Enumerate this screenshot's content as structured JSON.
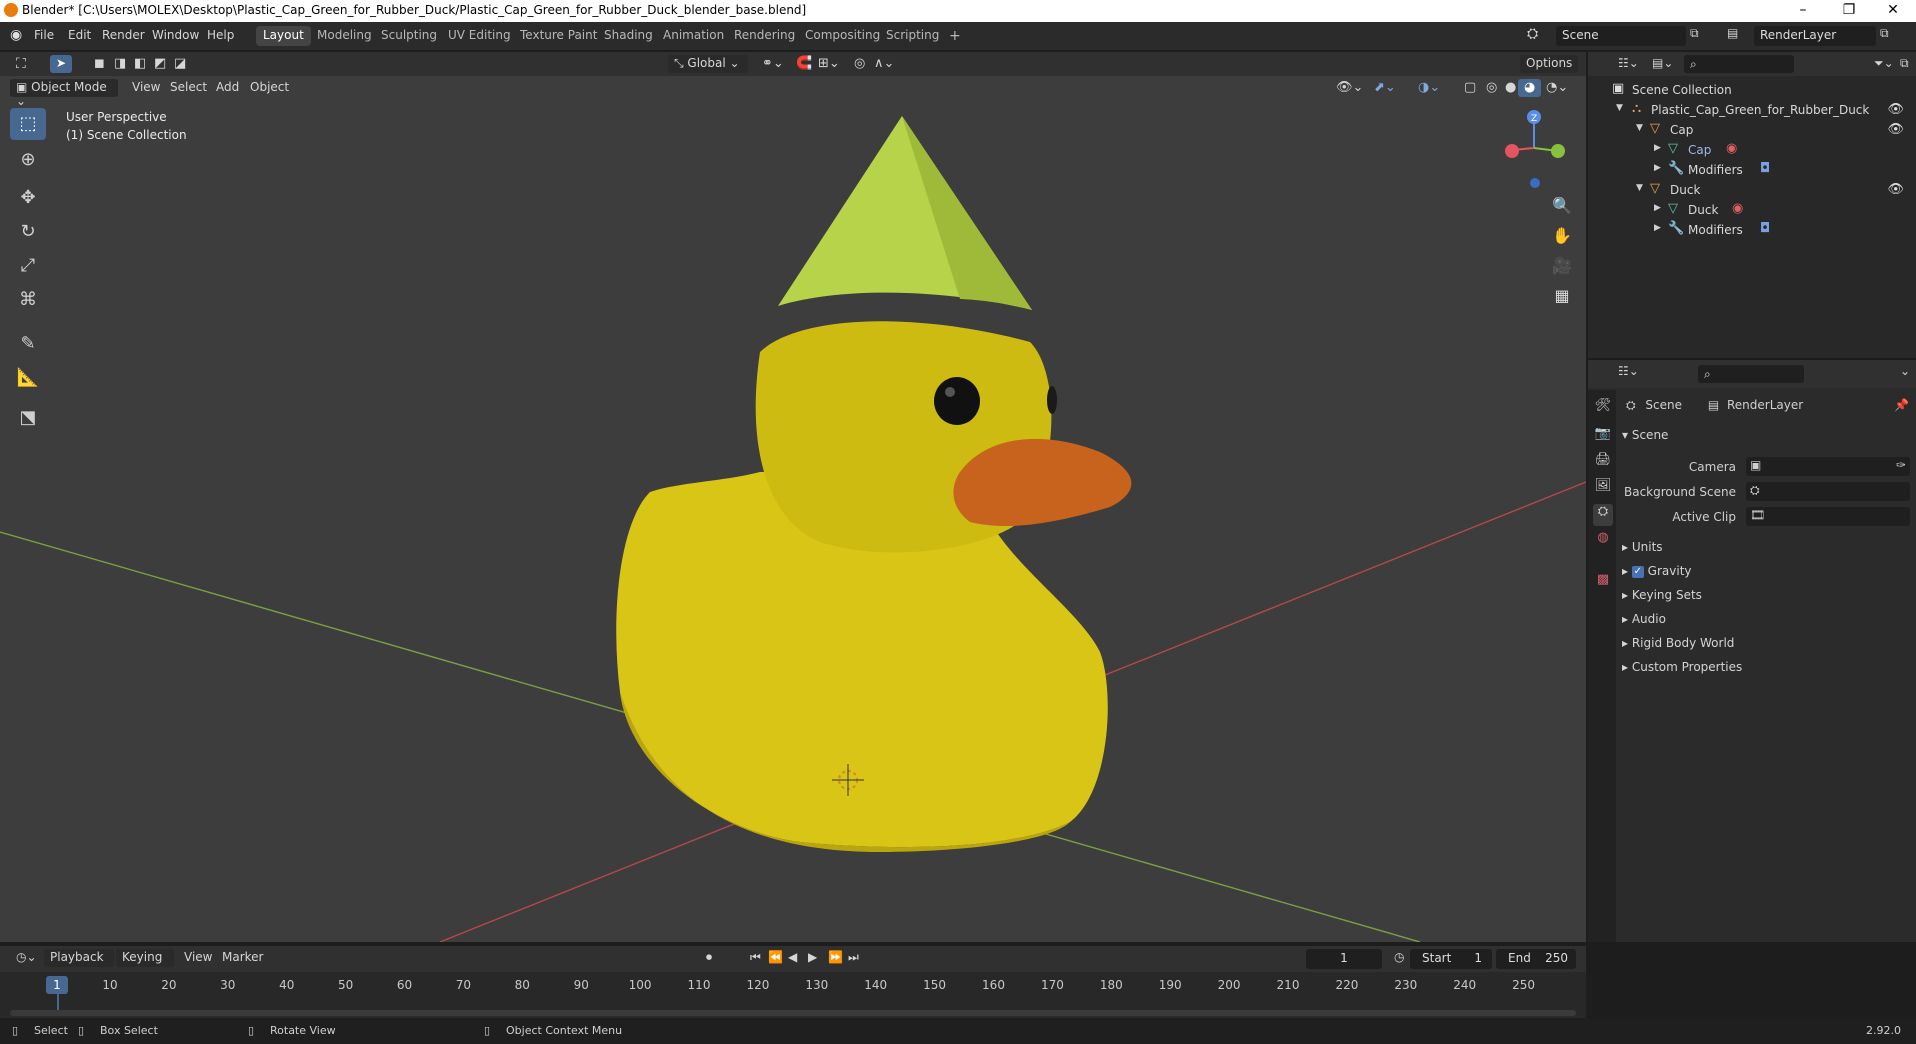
{
  "window": {
    "title": "Blender* [C:\\Users\\MOLEX\\Desktop\\Plastic_Cap_Green_for_Rubber_Duck/Plastic_Cap_Green_for_Rubber_Duck_blender_base.blend]",
    "minimize": "–",
    "restore": "❐",
    "close": "✕"
  },
  "menu": [
    "File",
    "Edit",
    "Render",
    "Window",
    "Help"
  ],
  "workspaces": [
    "Layout",
    "Modeling",
    "Sculpting",
    "UV Editing",
    "Texture Paint",
    "Shading",
    "Animation",
    "Rendering",
    "Compositing",
    "Scripting",
    "+"
  ],
  "scene_field": "Scene",
  "renderlayer_field": "RenderLayer",
  "viewport": {
    "transform_orientation": "Global",
    "options_label": "Options",
    "mode": "Object Mode",
    "menus": [
      "View",
      "Select",
      "Add",
      "Object"
    ],
    "overlay_title": "User Perspective",
    "overlay_subtitle": "(1) Scene Collection",
    "gizmo_axis": "Z"
  },
  "outliner": {
    "root": "Scene Collection",
    "items": [
      {
        "label": "Plastic_Cap_Green_for_Rubber_Duck"
      },
      {
        "label": "Cap"
      },
      {
        "label": "Cap"
      },
      {
        "label": "Modifiers"
      },
      {
        "label": "Duck"
      },
      {
        "label": "Duck"
      },
      {
        "label": "Modifiers"
      }
    ]
  },
  "properties": {
    "breadcrumb_scene": "Scene",
    "breadcrumb_layer": "RenderLayer",
    "section_scene": "Scene",
    "camera_label": "Camera",
    "background_scene_label": "Background Scene",
    "active_clip_label": "Active Clip",
    "panels": [
      "Units",
      "Gravity",
      "Keying Sets",
      "Audio",
      "Rigid Body World",
      "Custom Properties"
    ],
    "gravity_checked": true
  },
  "timeline": {
    "menus": [
      "Playback",
      "Keying",
      "View",
      "Marker"
    ],
    "current_frame": "1",
    "start_label": "Start",
    "start_value": "1",
    "end_label": "End",
    "end_value": "250",
    "ticks": [
      "1",
      "10",
      "20",
      "30",
      "40",
      "50",
      "60",
      "70",
      "80",
      "90",
      "100",
      "110",
      "120",
      "130",
      "140",
      "150",
      "160",
      "170",
      "180",
      "190",
      "200",
      "210",
      "220",
      "230",
      "240",
      "250"
    ]
  },
  "statusbar": {
    "select": "Select",
    "box_select": "Box Select",
    "rotate_view": "Rotate View",
    "context_menu": "Object Context Menu",
    "version": "2.92.0"
  },
  "colors": {
    "accent_blue": "#476890",
    "cap_green": "#b7d34a",
    "duck_yellow": "#d8c515",
    "beak_orange": "#c7631c",
    "x_axis": "#b3484f",
    "y_axis": "#7aa044"
  }
}
